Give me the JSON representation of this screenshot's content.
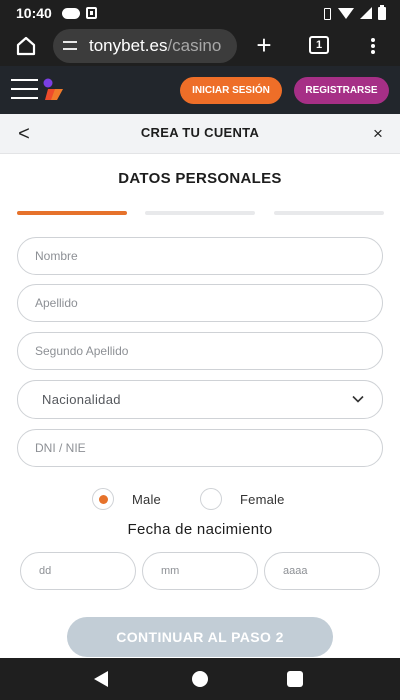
{
  "status_bar": {
    "time": "10:40"
  },
  "browser": {
    "url_domain": "tonybet.es",
    "url_path": "/casino",
    "tab_count": "1"
  },
  "site_header": {
    "login_label": "INICIAR SESIÓN",
    "register_label": "REGISTRARSE"
  },
  "modal": {
    "back_symbol": "<",
    "title": "CREA TU CUENTA",
    "close_symbol": "×"
  },
  "form": {
    "section_title": "DATOS PERSONALES",
    "steps": {
      "total": 3,
      "active": 1
    },
    "nombre_placeholder": "Nombre",
    "apellido_placeholder": "Apellido",
    "segundo_apellido_placeholder": "Segundo Apellido",
    "nacionalidad_value": "Nacionalidad",
    "dni_placeholder": "DNI / NIE",
    "gender": {
      "male_label": "Male",
      "female_label": "Female",
      "selected": "Male"
    },
    "dob_title": "Fecha de nacimiento",
    "dob_dd_placeholder": "dd",
    "dob_mm_placeholder": "mm",
    "dob_aaaa_placeholder": "aaaa",
    "continue_label": "CONTINUAR AL PASO 2"
  },
  "colors": {
    "accent_orange": "#e6722b",
    "register_purple": "#a62f86",
    "header_dark": "#22262c",
    "button_disabled": "#c2cdd6"
  }
}
